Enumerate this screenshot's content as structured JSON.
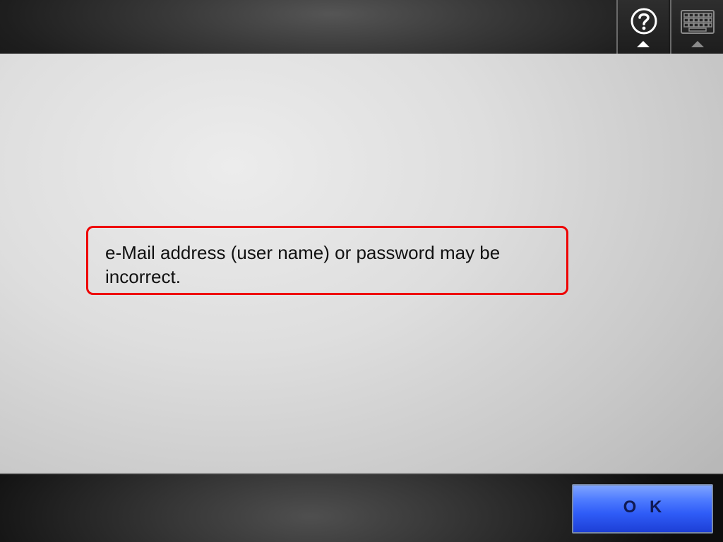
{
  "header": {
    "help_icon": "help-question-icon",
    "keyboard_icon": "keyboard-icon",
    "arrow_icon": "up-arrow-icon"
  },
  "dialog": {
    "message": "e-Mail address (user name) or password may be incorrect.",
    "border_color": "#ee0000"
  },
  "footer": {
    "ok_label": "O K",
    "ok_color": "#2f5cf7"
  }
}
